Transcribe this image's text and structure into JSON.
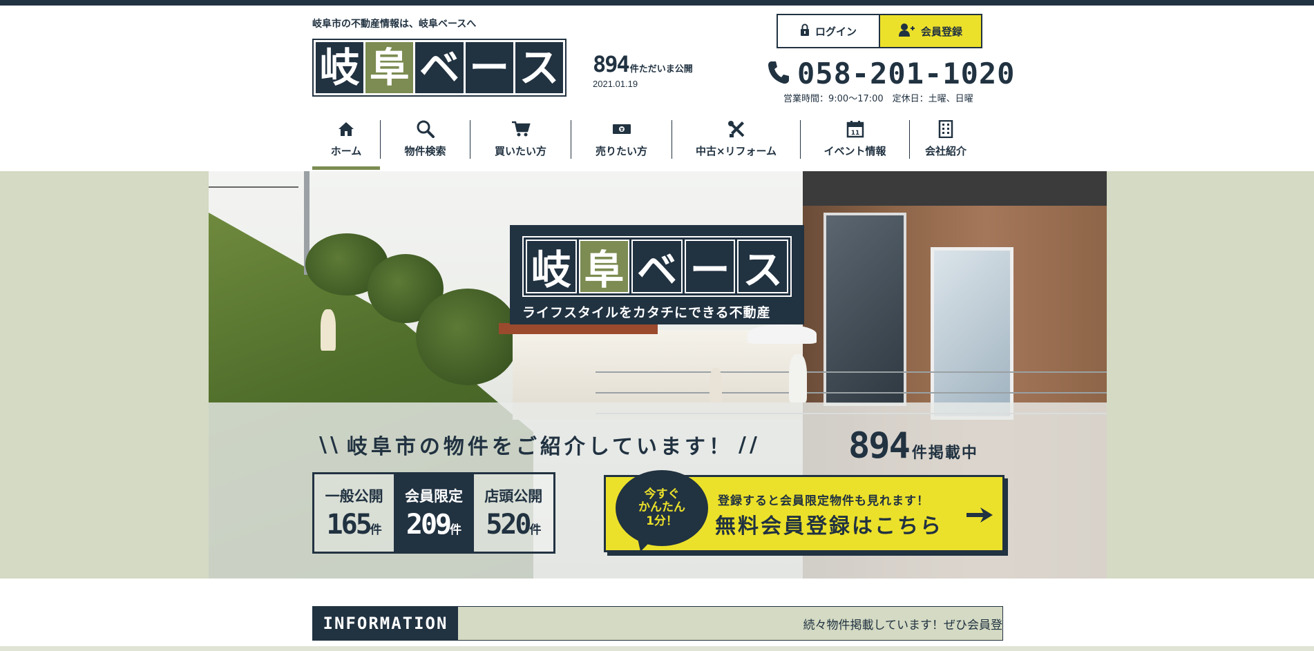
{
  "header": {
    "tagline": "岐阜市の不動産情報は、岐阜ベースへ",
    "logo_chars": [
      "岐",
      "阜",
      "ベ",
      "ー",
      "ス"
    ],
    "count": "894",
    "count_suffix": "件ただいま公開",
    "date": "2021.01.19",
    "login_label": "ログイン",
    "register_label": "会員登録",
    "phone": "058-201-1020",
    "hours": "営業時間：9:00〜17:00　定休日：土曜、日曜"
  },
  "nav": {
    "items": [
      {
        "label": "ホーム",
        "icon": "home-icon"
      },
      {
        "label": "物件検索",
        "icon": "search-icon"
      },
      {
        "label": "買いたい方",
        "icon": "cart-icon"
      },
      {
        "label": "売りたい方",
        "icon": "money-icon"
      },
      {
        "label": "中古×リフォーム",
        "icon": "tools-icon"
      },
      {
        "label": "イベント情報",
        "icon": "calendar-icon"
      },
      {
        "label": "会社紹介",
        "icon": "building-icon"
      }
    ]
  },
  "hero": {
    "logo_chars": [
      "岐",
      "阜",
      "ベ",
      "ー",
      "ス"
    ],
    "logo_tagline": "ライフスタイルをカタチにできる不動産",
    "headline": "岐阜市の物件をご紹介しています！",
    "listing_count": "894",
    "listing_label": "件掲載中",
    "stats": [
      {
        "label": "一般公開",
        "count": "165",
        "unit": "件"
      },
      {
        "label": "会員限定",
        "count": "209",
        "unit": "件"
      },
      {
        "label": "店頭公開",
        "count": "520",
        "unit": "件"
      }
    ],
    "cta_bubble": [
      "今すぐ",
      "かんたん",
      "1分！"
    ],
    "cta_sub": "登録すると会員限定物件も見れます！",
    "cta_main": "無料会員登録はこちら"
  },
  "info": {
    "label": "INFORMATION",
    "text": "続々物件掲載しています！ぜひ会員登"
  },
  "colors": {
    "navy": "#213241",
    "olive": "#7c8c52",
    "yellow": "#ece12a",
    "band": "#d4dac3"
  }
}
